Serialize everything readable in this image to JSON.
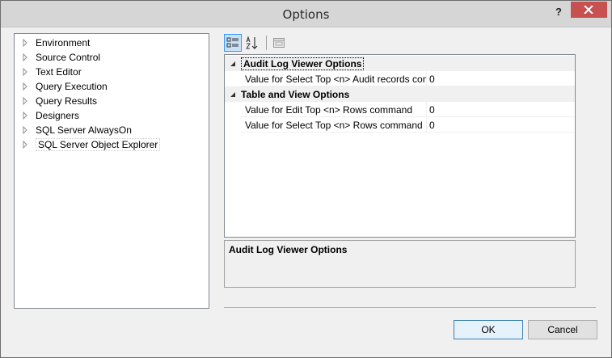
{
  "window": {
    "title": "Options",
    "help_label": "?"
  },
  "tree": {
    "items": [
      {
        "label": "Environment"
      },
      {
        "label": "Source Control"
      },
      {
        "label": "Text Editor"
      },
      {
        "label": "Query Execution"
      },
      {
        "label": "Query Results"
      },
      {
        "label": "Designers"
      },
      {
        "label": "SQL Server AlwaysOn"
      },
      {
        "label": "SQL Server Object Explorer"
      }
    ],
    "selected_index": 7
  },
  "toolbar": {
    "buttons": [
      "categorized-icon",
      "alphabetical-icon",
      "property-pages-icon"
    ]
  },
  "grid": {
    "categories": [
      {
        "label": "Audit Log Viewer Options",
        "properties": [
          {
            "name": "Value for Select Top <n> Audit records command",
            "value": "0"
          }
        ]
      },
      {
        "label": "Table and View Options",
        "properties": [
          {
            "name": "Value for Edit Top <n> Rows command",
            "value": "0"
          },
          {
            "name": "Value for Select Top <n> Rows command",
            "value": "0"
          }
        ]
      }
    ]
  },
  "description": {
    "title": "Audit Log Viewer Options"
  },
  "buttons": {
    "ok": "OK",
    "cancel": "Cancel"
  },
  "colors": {
    "close_button": "#c75050",
    "title_bar": "#d6d6d6",
    "selected_toolbar": "#c9e0f7"
  }
}
